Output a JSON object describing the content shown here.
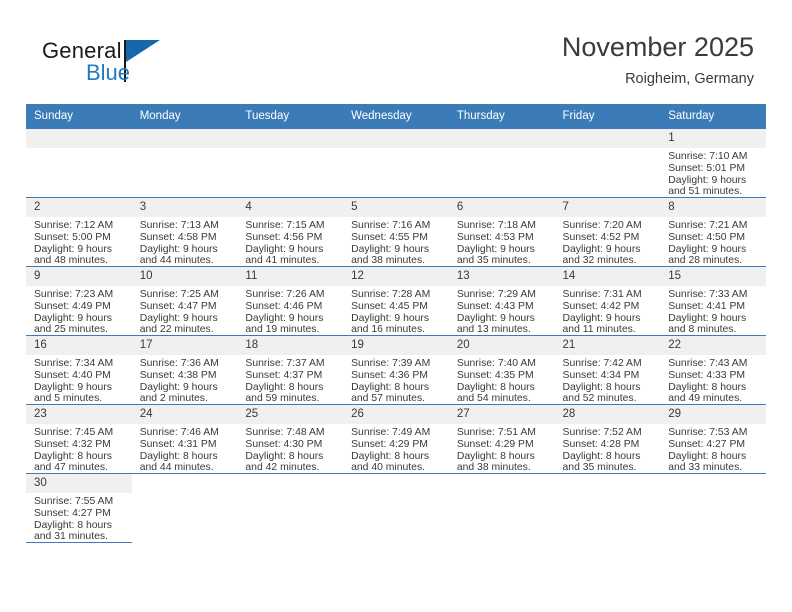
{
  "brand": {
    "name_part1": "General",
    "name_part2": "Blue",
    "logo_icon": "triangle-logo-icon"
  },
  "header": {
    "title": "November 2025",
    "subtitle": "Roigheim, Germany"
  },
  "calendar": {
    "weekday_headers": [
      "Sunday",
      "Monday",
      "Tuesday",
      "Wednesday",
      "Thursday",
      "Friday",
      "Saturday"
    ],
    "accent_color": "#3b7cb8",
    "daynum_bg_color": "#f0f0f0",
    "weeks": [
      [
        {
          "day": "",
          "lines": [],
          "empty": true
        },
        {
          "day": "",
          "lines": [],
          "empty": true
        },
        {
          "day": "",
          "lines": [],
          "empty": true
        },
        {
          "day": "",
          "lines": [],
          "empty": true
        },
        {
          "day": "",
          "lines": [],
          "empty": true
        },
        {
          "day": "",
          "lines": [],
          "empty": true
        },
        {
          "day": "1",
          "lines": [
            "Sunrise: 7:10 AM",
            "Sunset: 5:01 PM",
            "Daylight: 9 hours",
            "and 51 minutes."
          ],
          "empty": false
        }
      ],
      [
        {
          "day": "2",
          "lines": [
            "Sunrise: 7:12 AM",
            "Sunset: 5:00 PM",
            "Daylight: 9 hours",
            "and 48 minutes."
          ],
          "empty": false
        },
        {
          "day": "3",
          "lines": [
            "Sunrise: 7:13 AM",
            "Sunset: 4:58 PM",
            "Daylight: 9 hours",
            "and 44 minutes."
          ],
          "empty": false
        },
        {
          "day": "4",
          "lines": [
            "Sunrise: 7:15 AM",
            "Sunset: 4:56 PM",
            "Daylight: 9 hours",
            "and 41 minutes."
          ],
          "empty": false
        },
        {
          "day": "5",
          "lines": [
            "Sunrise: 7:16 AM",
            "Sunset: 4:55 PM",
            "Daylight: 9 hours",
            "and 38 minutes."
          ],
          "empty": false
        },
        {
          "day": "6",
          "lines": [
            "Sunrise: 7:18 AM",
            "Sunset: 4:53 PM",
            "Daylight: 9 hours",
            "and 35 minutes."
          ],
          "empty": false
        },
        {
          "day": "7",
          "lines": [
            "Sunrise: 7:20 AM",
            "Sunset: 4:52 PM",
            "Daylight: 9 hours",
            "and 32 minutes."
          ],
          "empty": false
        },
        {
          "day": "8",
          "lines": [
            "Sunrise: 7:21 AM",
            "Sunset: 4:50 PM",
            "Daylight: 9 hours",
            "and 28 minutes."
          ],
          "empty": false
        }
      ],
      [
        {
          "day": "9",
          "lines": [
            "Sunrise: 7:23 AM",
            "Sunset: 4:49 PM",
            "Daylight: 9 hours",
            "and 25 minutes."
          ],
          "empty": false
        },
        {
          "day": "10",
          "lines": [
            "Sunrise: 7:25 AM",
            "Sunset: 4:47 PM",
            "Daylight: 9 hours",
            "and 22 minutes."
          ],
          "empty": false
        },
        {
          "day": "11",
          "lines": [
            "Sunrise: 7:26 AM",
            "Sunset: 4:46 PM",
            "Daylight: 9 hours",
            "and 19 minutes."
          ],
          "empty": false
        },
        {
          "day": "12",
          "lines": [
            "Sunrise: 7:28 AM",
            "Sunset: 4:45 PM",
            "Daylight: 9 hours",
            "and 16 minutes."
          ],
          "empty": false
        },
        {
          "day": "13",
          "lines": [
            "Sunrise: 7:29 AM",
            "Sunset: 4:43 PM",
            "Daylight: 9 hours",
            "and 13 minutes."
          ],
          "empty": false
        },
        {
          "day": "14",
          "lines": [
            "Sunrise: 7:31 AM",
            "Sunset: 4:42 PM",
            "Daylight: 9 hours",
            "and 11 minutes."
          ],
          "empty": false
        },
        {
          "day": "15",
          "lines": [
            "Sunrise: 7:33 AM",
            "Sunset: 4:41 PM",
            "Daylight: 9 hours",
            "and 8 minutes."
          ],
          "empty": false
        }
      ],
      [
        {
          "day": "16",
          "lines": [
            "Sunrise: 7:34 AM",
            "Sunset: 4:40 PM",
            "Daylight: 9 hours",
            "and 5 minutes."
          ],
          "empty": false
        },
        {
          "day": "17",
          "lines": [
            "Sunrise: 7:36 AM",
            "Sunset: 4:38 PM",
            "Daylight: 9 hours",
            "and 2 minutes."
          ],
          "empty": false
        },
        {
          "day": "18",
          "lines": [
            "Sunrise: 7:37 AM",
            "Sunset: 4:37 PM",
            "Daylight: 8 hours",
            "and 59 minutes."
          ],
          "empty": false
        },
        {
          "day": "19",
          "lines": [
            "Sunrise: 7:39 AM",
            "Sunset: 4:36 PM",
            "Daylight: 8 hours",
            "and 57 minutes."
          ],
          "empty": false
        },
        {
          "day": "20",
          "lines": [
            "Sunrise: 7:40 AM",
            "Sunset: 4:35 PM",
            "Daylight: 8 hours",
            "and 54 minutes."
          ],
          "empty": false
        },
        {
          "day": "21",
          "lines": [
            "Sunrise: 7:42 AM",
            "Sunset: 4:34 PM",
            "Daylight: 8 hours",
            "and 52 minutes."
          ],
          "empty": false
        },
        {
          "day": "22",
          "lines": [
            "Sunrise: 7:43 AM",
            "Sunset: 4:33 PM",
            "Daylight: 8 hours",
            "and 49 minutes."
          ],
          "empty": false
        }
      ],
      [
        {
          "day": "23",
          "lines": [
            "Sunrise: 7:45 AM",
            "Sunset: 4:32 PM",
            "Daylight: 8 hours",
            "and 47 minutes."
          ],
          "empty": false
        },
        {
          "day": "24",
          "lines": [
            "Sunrise: 7:46 AM",
            "Sunset: 4:31 PM",
            "Daylight: 8 hours",
            "and 44 minutes."
          ],
          "empty": false
        },
        {
          "day": "25",
          "lines": [
            "Sunrise: 7:48 AM",
            "Sunset: 4:30 PM",
            "Daylight: 8 hours",
            "and 42 minutes."
          ],
          "empty": false
        },
        {
          "day": "26",
          "lines": [
            "Sunrise: 7:49 AM",
            "Sunset: 4:29 PM",
            "Daylight: 8 hours",
            "and 40 minutes."
          ],
          "empty": false
        },
        {
          "day": "27",
          "lines": [
            "Sunrise: 7:51 AM",
            "Sunset: 4:29 PM",
            "Daylight: 8 hours",
            "and 38 minutes."
          ],
          "empty": false
        },
        {
          "day": "28",
          "lines": [
            "Sunrise: 7:52 AM",
            "Sunset: 4:28 PM",
            "Daylight: 8 hours",
            "and 35 minutes."
          ],
          "empty": false
        },
        {
          "day": "29",
          "lines": [
            "Sunrise: 7:53 AM",
            "Sunset: 4:27 PM",
            "Daylight: 8 hours",
            "and 33 minutes."
          ],
          "empty": false
        }
      ],
      [
        {
          "day": "30",
          "lines": [
            "Sunrise: 7:55 AM",
            "Sunset: 4:27 PM",
            "Daylight: 8 hours",
            "and 31 minutes."
          ],
          "empty": false
        },
        {
          "day": "",
          "lines": [],
          "empty": true,
          "trailing": true
        },
        {
          "day": "",
          "lines": [],
          "empty": true,
          "trailing": true
        },
        {
          "day": "",
          "lines": [],
          "empty": true,
          "trailing": true
        },
        {
          "day": "",
          "lines": [],
          "empty": true,
          "trailing": true
        },
        {
          "day": "",
          "lines": [],
          "empty": true,
          "trailing": true
        },
        {
          "day": "",
          "lines": [],
          "empty": true,
          "trailing": true
        }
      ]
    ]
  }
}
